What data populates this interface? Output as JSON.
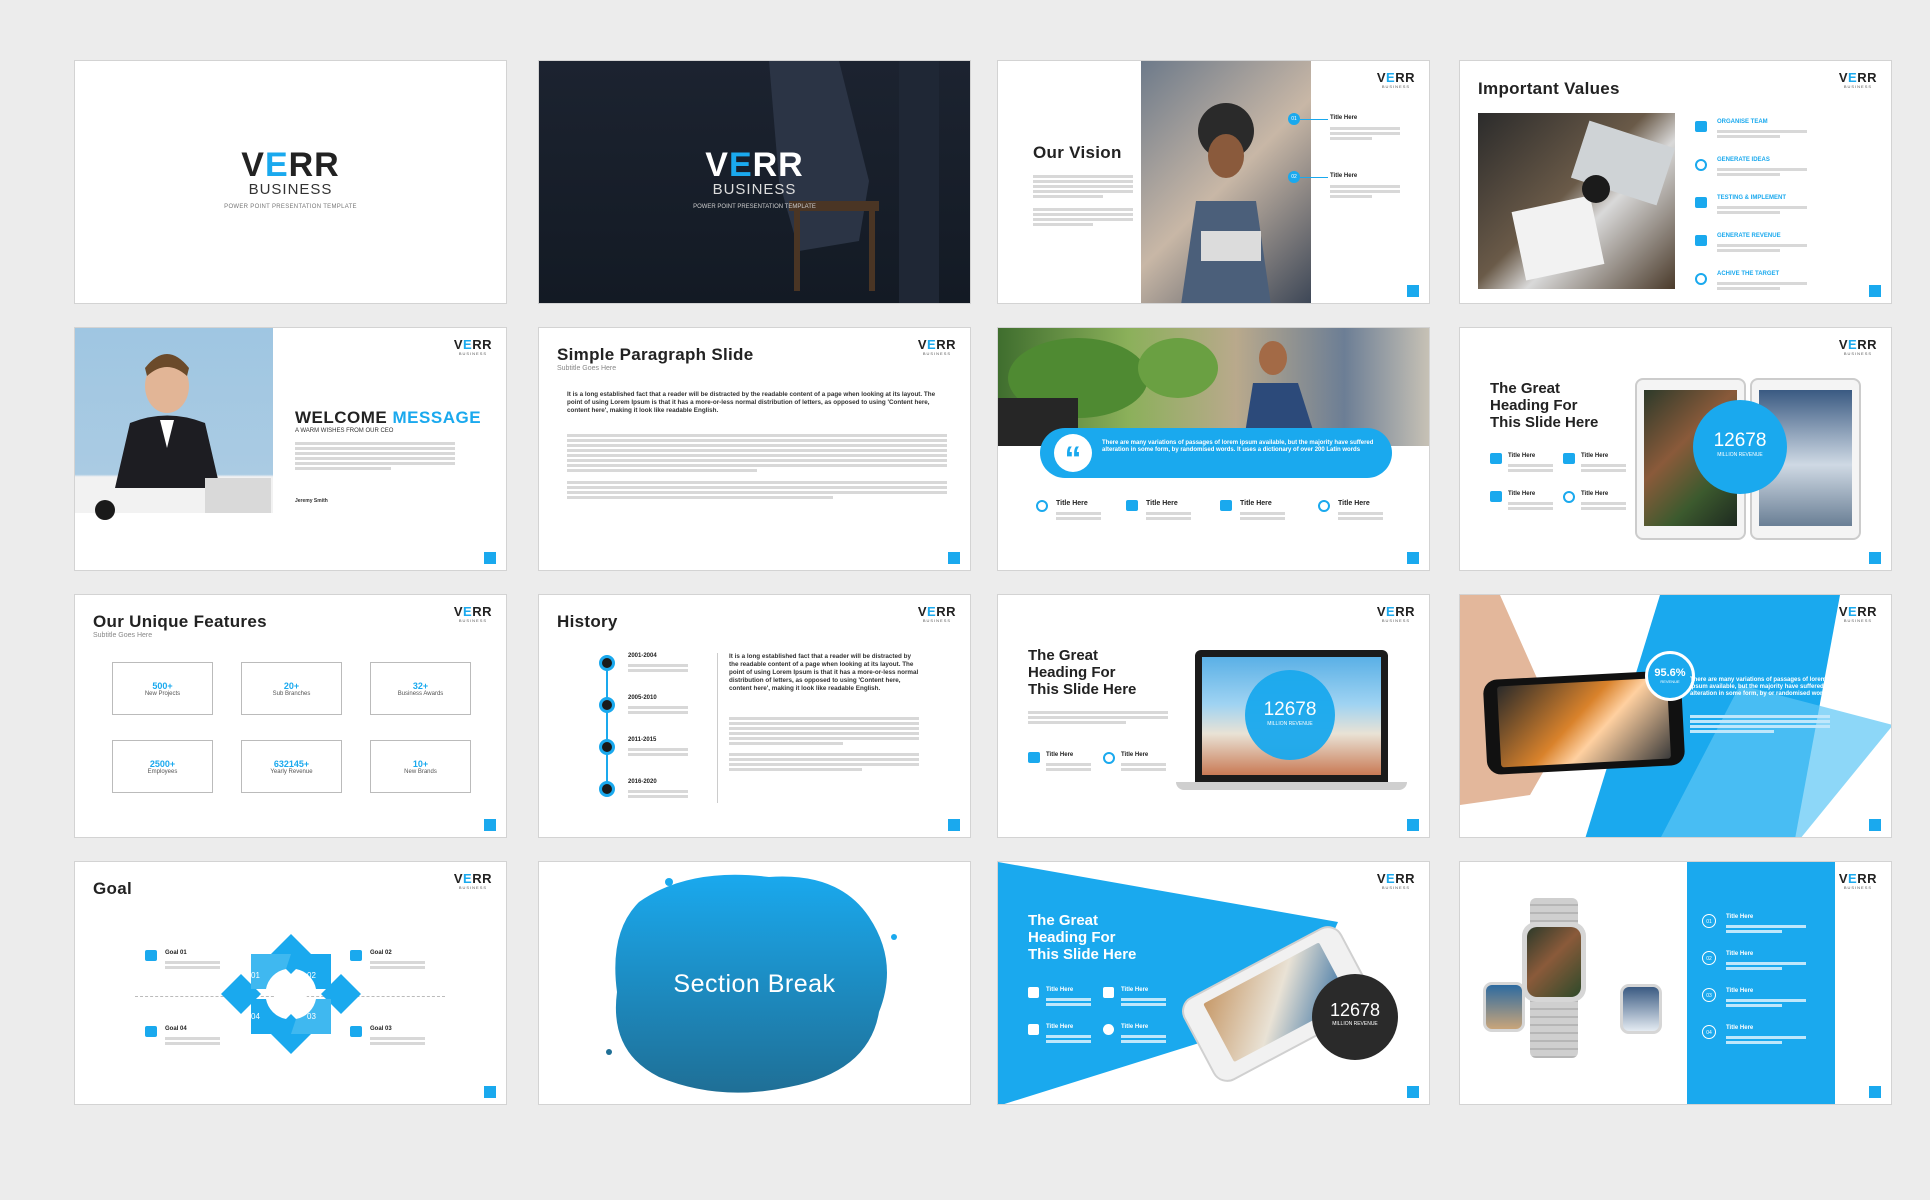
{
  "brand": {
    "name_pre": "V",
    "name_accent": "E",
    "name_post": "RR",
    "sub": "BUSINESS",
    "tagline": "POWER POINT PRESENTATION TEMPLATE",
    "small_sub": "BUSINESS"
  },
  "colors": {
    "accent": "#1aa9ee",
    "dark": "#1a2130",
    "background": "#ececec"
  },
  "slides": {
    "vision": {
      "title": "Our Vision",
      "items": [
        {
          "label": "Title Here",
          "num": "01"
        },
        {
          "label": "Title Here",
          "num": "02"
        }
      ]
    },
    "values": {
      "title": "Important Values",
      "items": [
        "ORGANISE TEAM",
        "GENERATE IDEAS",
        "TESTING & IMPLEMENT",
        "GENERATE REVENUE",
        "ACHIVE THE TARGET"
      ]
    },
    "welcome": {
      "title_a": "WELCOME",
      "title_b": "MESSAGE",
      "subtitle": "A WARM WISHES FROM OUR CEO",
      "signature": "Jeremy Smith"
    },
    "paragraph": {
      "title": "Simple Paragraph Slide",
      "subtitle": "Subtitle Goes Here",
      "lead": "It is a long established fact that a reader will be distracted by the readable content of a page when looking at its layout. The point of using Lorem Ipsum is that it has a more-or-less normal distribution of letters, as opposed to using 'Content here, content here', making it look like readable English."
    },
    "quote": {
      "text": "There are many variations of passages of lorem ipsum available, but the majority have suffered alteration in some form, by randomised words. It uses a dictionary of over 200 Latin words",
      "items": [
        "Title Here",
        "Title Here",
        "Title Here",
        "Title Here"
      ]
    },
    "tablets": {
      "heading": [
        "The Great",
        "Heading For",
        "This Slide Here"
      ],
      "stat": "12678",
      "stat_label": "MILLION REVENUE",
      "items": [
        "Title Here",
        "Title Here",
        "Title Here",
        "Title Here"
      ]
    },
    "features": {
      "title": "Our Unique Features",
      "subtitle": "Subtitle Goes Here",
      "items": [
        {
          "value": "500+",
          "label": "New Projects"
        },
        {
          "value": "20+",
          "label": "Sub Branches"
        },
        {
          "value": "32+",
          "label": "Business Awards"
        },
        {
          "value": "2500+",
          "label": "Employees"
        },
        {
          "value": "632145+",
          "label": "Yearly Revenue"
        },
        {
          "value": "10+",
          "label": "New Brands"
        }
      ]
    },
    "history": {
      "title": "History",
      "years": [
        "2001-2004",
        "2005-2010",
        "2011-2015",
        "2016-2020"
      ],
      "lead": "It is a long established fact that a reader will be distracted by the readable content of a page when looking at its layout. The point of using Lorem Ipsum is that it has a more-or-less normal distribution of letters, as opposed to using 'Content here, content here', making it look like readable English."
    },
    "laptop": {
      "heading": [
        "The Great",
        "Heading For",
        "This Slide Here"
      ],
      "stat": "12678",
      "stat_label": "MILLION REVENUE",
      "items": [
        "Title Here",
        "Title Here"
      ]
    },
    "phone_hand": {
      "stat": "95.6%",
      "stat_label": "REVENUE",
      "text": "There are many variations of passages of lorem ipsum available, but the majority have suffered alteration in some form, by or randomised words"
    },
    "goal": {
      "title": "Goal",
      "goals": [
        "Goal 01",
        "Goal 02",
        "Goal 04",
        "Goal 03"
      ],
      "nums": [
        "01",
        "02",
        "04",
        "03"
      ]
    },
    "section": {
      "title": "Section Break"
    },
    "phone_blue": {
      "heading": [
        "The Great",
        "Heading For",
        "This Slide Here"
      ],
      "stat": "12678",
      "stat_label": "MILLION REVENUE",
      "items": [
        "Title Here",
        "Title Here",
        "Title Here",
        "Title Here"
      ]
    },
    "watch": {
      "items": [
        {
          "num": "01",
          "label": "Title Here"
        },
        {
          "num": "02",
          "label": "Title Here"
        },
        {
          "num": "03",
          "label": "Title Here"
        },
        {
          "num": "04",
          "label": "Title Here"
        }
      ]
    }
  }
}
